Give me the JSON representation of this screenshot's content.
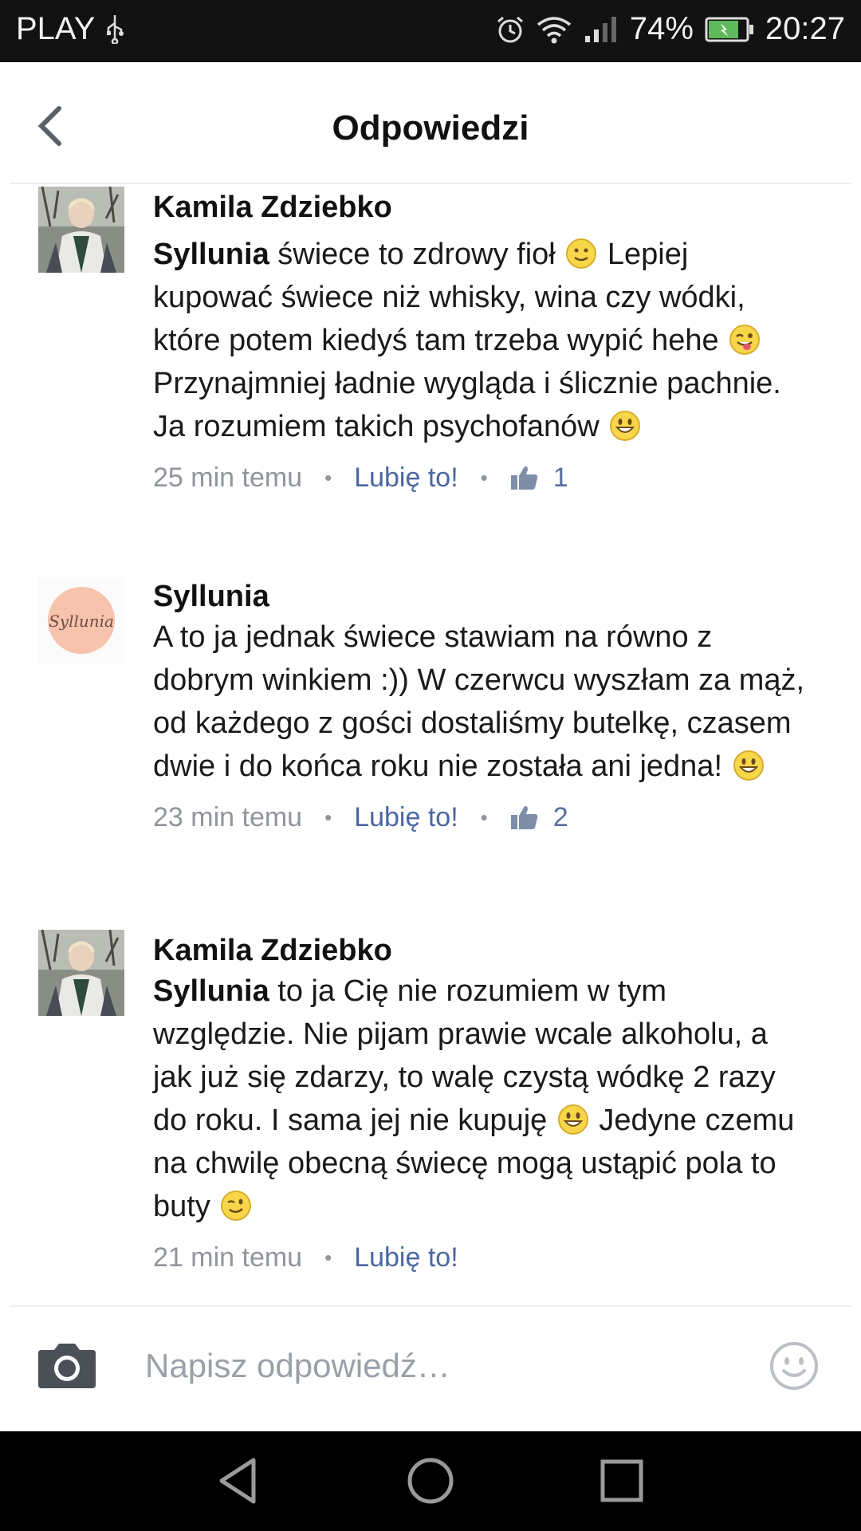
{
  "status_bar": {
    "carrier": "PLAY",
    "battery": "74%",
    "time": "20:27",
    "icons": [
      "usb-icon",
      "alarm-icon",
      "wifi-icon",
      "signal-icon",
      "battery-charging-icon"
    ]
  },
  "header": {
    "title": "Odpowiedzi",
    "back_icon": "chevron-left-icon"
  },
  "comments": [
    {
      "author": "Kamila Zdziebko",
      "mention": "Syllunia",
      "text_parts": [
        " świece to zdrowy fioł ",
        " Lepiej kupować świece niż whisky, wina czy wódki, które potem kiedyś tam trzeba wypić hehe ",
        " Przynajmniej ładnie wygląda i ślicznie pachnie. Ja rozumiem takich psychofanów "
      ],
      "emojis": [
        "slight-smile-emoji",
        "tongue-wink-emoji",
        "grin-emoji"
      ],
      "time": "25 min temu",
      "like_label": "Lubię to!",
      "likes": "1"
    },
    {
      "author": "Syllunia",
      "avatar_text": "Syllunia",
      "text_parts": [
        "A to ja jednak świece stawiam na równo z dobrym winkiem :)) W czerwcu wyszłam za mąż, od każdego z gości dostaliśmy butelkę, czasem dwie i do końca roku nie została ani jedna! "
      ],
      "emojis": [
        "grin-emoji"
      ],
      "time": "23 min temu",
      "like_label": "Lubię to!",
      "likes": "2"
    },
    {
      "author": "Kamila Zdziebko",
      "mention": "Syllunia",
      "text_parts": [
        " to ja Cię nie rozumiem w tym względzie. Nie pijam prawie wcale alkoholu, a jak już się zdarzy, to walę czystą wódkę 2 razy do roku. I sama jej nie kupuję ",
        " Jedyne czemu na chwilę obecną świecę mogą ustąpić pola to buty "
      ],
      "emojis": [
        "grin-emoji",
        "wink-emoji"
      ],
      "time": "21 min temu",
      "like_label": "Lubię to!"
    }
  ],
  "reply_bar": {
    "placeholder": "Napisz odpowiedź…",
    "camera_icon": "camera-icon",
    "emoji_icon": "smiley-icon"
  },
  "nav_bar": {
    "icons": [
      "back-triangle-icon",
      "home-circle-icon",
      "recents-square-icon"
    ]
  },
  "colors": {
    "link": "#4b67a1",
    "meta": "#90949c",
    "status_bar_bg": "#121212"
  }
}
